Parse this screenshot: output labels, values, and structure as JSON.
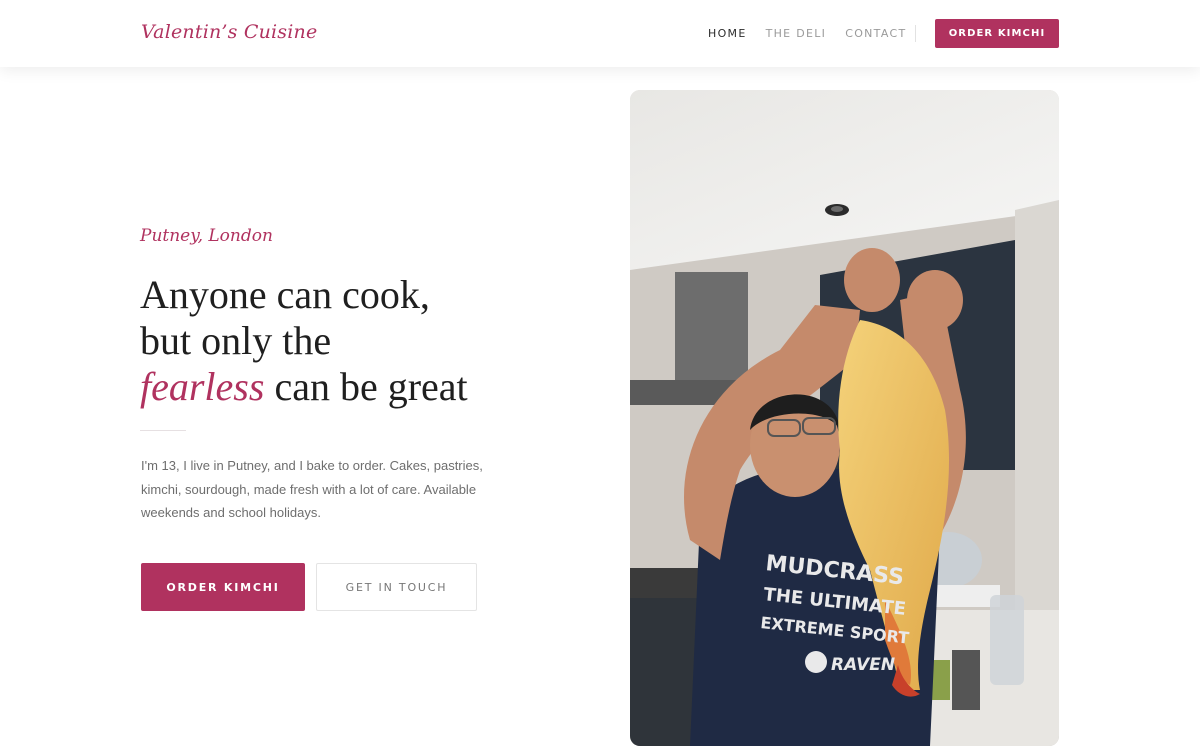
{
  "brand": {
    "name": "Valentin’s Cuisine"
  },
  "nav": {
    "items": [
      {
        "label": "HOME",
        "active": true
      },
      {
        "label": "THE DELI",
        "active": false
      },
      {
        "label": "CONTACT",
        "active": false
      }
    ],
    "cta_label": "ORDER KIMCHI"
  },
  "hero": {
    "location": "Putney, London",
    "headline_line1": "Anyone can cook,",
    "headline_line2": "but only the",
    "headline_accent": "fearless",
    "headline_rest": " can be great",
    "intro": "I'm 13, I live in Putney, and I bake to order. Cakes, pastries, kimchi, sourdough, made fresh with a lot of care. Available weekends and school holidays.",
    "primary_button": "ORDER KIMCHI",
    "secondary_button": "GET IN TOUCH"
  },
  "photo": {
    "shirt_line1": "MUDCRASS",
    "shirt_line2": "THE ULTIMATE",
    "shirt_line3": "EXTREME SPORT",
    "shirt_logo": "RAVEN"
  },
  "colors": {
    "accent": "#b0325f",
    "text_dark": "#1f1f1f",
    "text_muted": "#6e6e6e",
    "nav_muted": "#9a9a9a"
  }
}
